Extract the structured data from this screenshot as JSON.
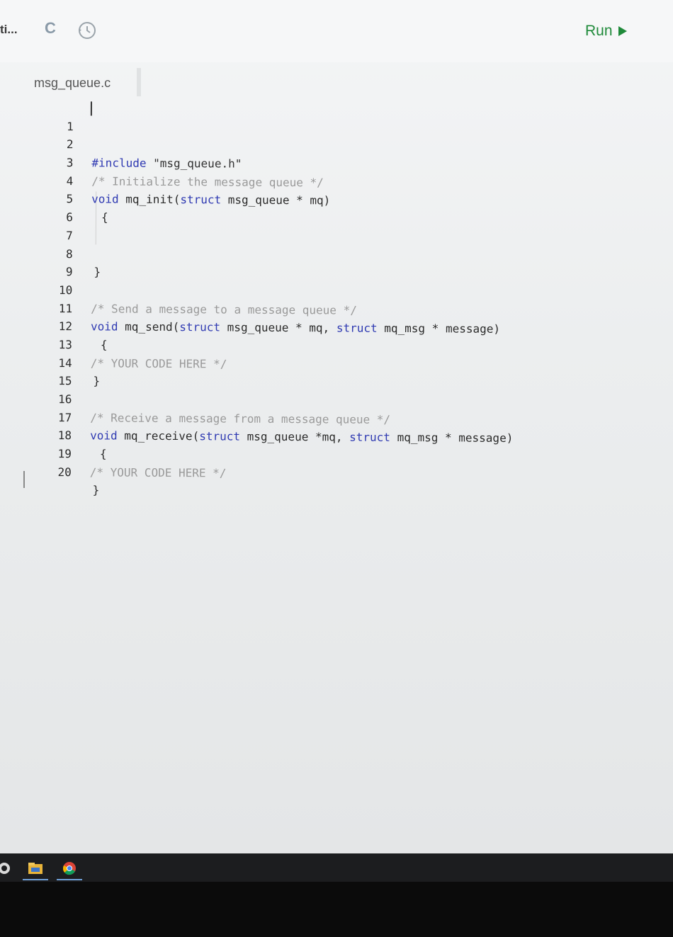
{
  "topbar": {
    "truncated_label": "ti...",
    "language_badge": "C",
    "run_label": "Run"
  },
  "editor": {
    "filename": "msg_queue.c",
    "lines": [
      {
        "n": "1"
      },
      {
        "n": "2"
      },
      {
        "n": "3"
      },
      {
        "n": "4"
      },
      {
        "n": "5"
      },
      {
        "n": "6"
      },
      {
        "n": "7"
      },
      {
        "n": "8"
      },
      {
        "n": "9"
      },
      {
        "n": "10"
      },
      {
        "n": "11"
      },
      {
        "n": "12"
      },
      {
        "n": "13"
      },
      {
        "n": "14"
      },
      {
        "n": "15"
      },
      {
        "n": "16"
      },
      {
        "n": "17"
      },
      {
        "n": "18"
      },
      {
        "n": "19"
      },
      {
        "n": "20"
      }
    ],
    "code": {
      "l1_directive": "#include",
      "l1_string": "\"msg_queue.h\"",
      "l3_comment": "/* Initialize the message queue */",
      "l4_void": "void",
      "l4_name": "mq_init(",
      "l4_struct": "struct",
      "l4_rest": "msg_queue * mq)",
      "l5": "{",
      "l8": "}",
      "l10_comment": "/* Send a message to a message queue */",
      "l11_void": "void",
      "l11_name": "mq_send(",
      "l11_struct1": "struct",
      "l11_mid": "msg_queue * mq,",
      "l11_struct2": "struct",
      "l11_rest": "mq_msg * message)",
      "l12": "{",
      "l13_comment": "/* YOUR CODE HERE */",
      "l14": "}",
      "l16_comment": "/* Receive a message from a message queue */",
      "l17_void": "void",
      "l17_name": "mq_receive(",
      "l17_struct1": "struct",
      "l17_mid": "msg_queue *mq,",
      "l17_struct2": "struct",
      "l17_rest": "mq_msg * message)",
      "l18": "{",
      "l19_comment": "/* YOUR CODE HERE */",
      "l20": "}"
    }
  },
  "colors": {
    "run_green": "#1f8a3a",
    "keyword_blue": "#2f3ab2",
    "comment_gray": "#9a9a9a"
  },
  "taskbar": {
    "icons": [
      "app-icon",
      "file-explorer-icon",
      "chrome-icon"
    ]
  }
}
